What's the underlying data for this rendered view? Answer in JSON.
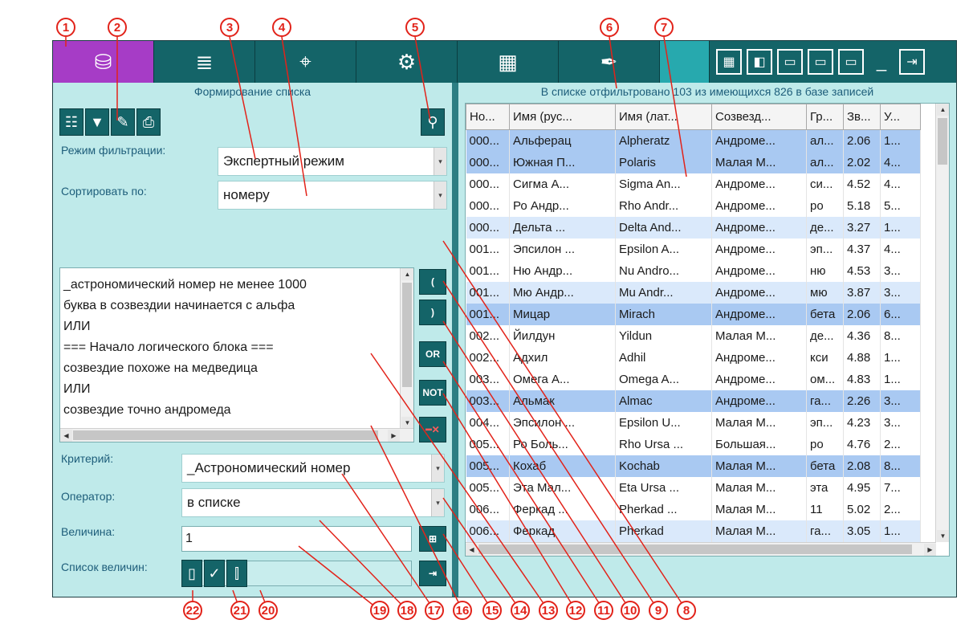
{
  "toolbar": {
    "tabs": [
      {
        "name": "database",
        "icon": "⛁"
      },
      {
        "name": "list",
        "icon": "≣"
      },
      {
        "name": "target",
        "icon": "⌖"
      },
      {
        "name": "settings",
        "icon": "⚙"
      },
      {
        "name": "calculator",
        "icon": "▦"
      },
      {
        "name": "feather",
        "icon": "✒"
      },
      {
        "name": "blank",
        "icon": ""
      }
    ],
    "window_buttons": [
      "▦",
      "◧",
      "▭",
      "▭",
      "▭",
      "_",
      "⇥"
    ]
  },
  "left": {
    "caption": "Формирование списка",
    "filter_mode_label": "Режим фильтрации:",
    "filter_mode_value": "Экспертный режим",
    "sort_label": "Сортировать по:",
    "sort_value": "номеру",
    "expression_lines": [
      "_астрономический номер не менее 1000",
      "буква в созвездии начинается с альфа",
      "ИЛИ",
      "=== Начало логического блока ===",
      "созвездие похоже на медведица",
      "ИЛИ",
      "созвездие точно андромеда"
    ],
    "side_buttons": [
      "(",
      ")",
      "OR",
      "NOT",
      "━✕"
    ],
    "criterion_label": "Критерий:",
    "criterion_value": "_Астрономический номер",
    "operator_label": "Оператор:",
    "operator_value": "в списке",
    "value_label": "Величина:",
    "value_value": "1",
    "list_label": "Список величин:",
    "list_value": ""
  },
  "right": {
    "caption": "В списке отфильтровано 103 из имеющихся 826 в базе записей",
    "columns": [
      "Но...",
      "Имя (рус...",
      "Имя (лат...",
      "Созвезд...",
      "Гр...",
      "Зв...",
      "У..."
    ],
    "rows": [
      {
        "c": [
          "000...",
          "Альферац",
          "Alpheratz",
          "Андроме...",
          "ал...",
          "2.06",
          "1..."
        ],
        "s": "hl"
      },
      {
        "c": [
          "000...",
          "Южная П...",
          "Polaris",
          "Малая М...",
          "ал...",
          "2.02",
          "4..."
        ],
        "s": "hl"
      },
      {
        "c": [
          "000...",
          "Сигма А...",
          "Sigma An...",
          "Андроме...",
          "си...",
          "4.52",
          "4..."
        ],
        "s": "plain"
      },
      {
        "c": [
          "000...",
          "Ро Андр...",
          "Rho Andr...",
          "Андроме...",
          "ро",
          "5.18",
          "5..."
        ],
        "s": "plain"
      },
      {
        "c": [
          "000...",
          "Дельта ...",
          "Delta And...",
          "Андроме...",
          "де...",
          "3.27",
          "1..."
        ],
        "s": "alt"
      },
      {
        "c": [
          "001...",
          "Эпсилон ...",
          "Epsilon A...",
          "Андроме...",
          "эп...",
          "4.37",
          "4..."
        ],
        "s": "plain"
      },
      {
        "c": [
          "001...",
          "Ню Андр...",
          "Nu Andro...",
          "Андроме...",
          "ню",
          "4.53",
          "3..."
        ],
        "s": "plain"
      },
      {
        "c": [
          "001...",
          "Мю Андр...",
          "Mu Andr...",
          "Андроме...",
          "мю",
          "3.87",
          "3..."
        ],
        "s": "alt"
      },
      {
        "c": [
          "001...",
          "Мицар",
          "Mirach",
          "Андроме...",
          "бета",
          "2.06",
          "6..."
        ],
        "s": "hl"
      },
      {
        "c": [
          "002...",
          "Йилдун",
          "Yildun",
          "Малая М...",
          "де...",
          "4.36",
          "8..."
        ],
        "s": "plain"
      },
      {
        "c": [
          "002...",
          "Адхил",
          "Adhil",
          "Андроме...",
          "кси",
          "4.88",
          "1..."
        ],
        "s": "plain"
      },
      {
        "c": [
          "003...",
          "Омега А...",
          "Omega A...",
          "Андроме...",
          "ом...",
          "4.83",
          "1..."
        ],
        "s": "plain"
      },
      {
        "c": [
          "003...",
          "Альмак",
          "Almac",
          "Андроме...",
          "га...",
          "2.26",
          "3..."
        ],
        "s": "hl"
      },
      {
        "c": [
          "004...",
          "Эпсилон ...",
          "Epsilon U...",
          "Малая М...",
          "эп...",
          "4.23",
          "3..."
        ],
        "s": "plain"
      },
      {
        "c": [
          "005...",
          "Ро Боль...",
          "Rho Ursa ...",
          "Большая...",
          "ро",
          "4.76",
          "2..."
        ],
        "s": "plain"
      },
      {
        "c": [
          "005...",
          "Кохаб",
          "Kochab",
          "Малая М...",
          "бета",
          "2.08",
          "8..."
        ],
        "s": "hl"
      },
      {
        "c": [
          "005...",
          "Эта Мал...",
          "Eta Ursa ...",
          "Малая М...",
          "эта",
          "4.95",
          "7..."
        ],
        "s": "plain"
      },
      {
        "c": [
          "006...",
          "Феркад ...",
          "Pherkad ...",
          "Малая М...",
          "11",
          "5.02",
          "2..."
        ],
        "s": "plain"
      },
      {
        "c": [
          "006...",
          "Феркад",
          "Pherkad",
          "Малая М...",
          "га...",
          "3.05",
          "1..."
        ],
        "s": "alt"
      }
    ]
  },
  "callouts": [
    "1",
    "2",
    "3",
    "4",
    "5",
    "6",
    "7",
    "8",
    "9",
    "10",
    "11",
    "12",
    "13",
    "14",
    "15",
    "16",
    "17",
    "18",
    "19",
    "20",
    "21",
    "22"
  ],
  "colors": {
    "toolbar": "#146468",
    "active_tab": "#a63cc6",
    "panel_bg": "#bfeaea",
    "row_highlight": "#a9c9f2",
    "row_alt": "#dae9fb",
    "callout": "#e2231a"
  }
}
